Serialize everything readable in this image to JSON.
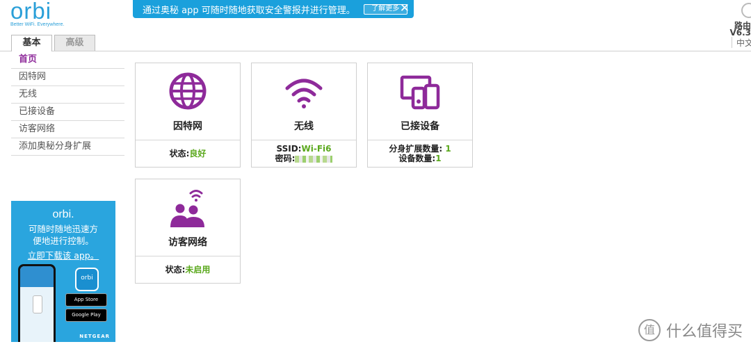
{
  "brand": {
    "name": "orbi",
    "tagline": "Better WiFi. Everywhere."
  },
  "banner": {
    "text": "通过奥秘 app 可随时随地获取安全警报并进行管理。",
    "more_label": "了解更多",
    "close": "✕"
  },
  "top_right": {
    "label": "路由",
    "version": "V6.3",
    "language": "中文"
  },
  "tabs": [
    {
      "label": "基本"
    },
    {
      "label": "高级"
    }
  ],
  "sidebar": {
    "items": [
      {
        "label": "首页"
      },
      {
        "label": "因特网"
      },
      {
        "label": "无线"
      },
      {
        "label": "已接设备"
      },
      {
        "label": "访客网络"
      },
      {
        "label": "添加奥秘分身扩展"
      }
    ]
  },
  "ad": {
    "logo": "orbi.",
    "line1": "可随时随地迅速方",
    "line2": "便地进行控制。",
    "link": "立即下载该 app。",
    "app_logo": "orbi",
    "appstore": "App Store",
    "googleplay": "Google Play",
    "maker": "NETGEAR"
  },
  "cards": {
    "internet": {
      "title": "因特网",
      "status_label": "状态:",
      "status_value": "良好"
    },
    "wireless": {
      "title": "无线",
      "ssid_label": "SSID:",
      "ssid_value": "Wi-Fi6",
      "password_label": "密码:"
    },
    "devices": {
      "title": "已接设备",
      "satellites_label": "分身扩展数量:",
      "satellites_value": "1",
      "devices_label": "设备数量:",
      "devices_value": "1"
    },
    "guest": {
      "title": "访客网络",
      "status_label": "状态:",
      "status_value": "未启用"
    }
  },
  "colors": {
    "accent": "#8e2a9a",
    "banner": "#1aa0dc",
    "ok_green": "#5aa81c",
    "brand_blue": "#2a9fd8"
  },
  "watermark": {
    "icon": "值",
    "text": "什么值得买"
  }
}
